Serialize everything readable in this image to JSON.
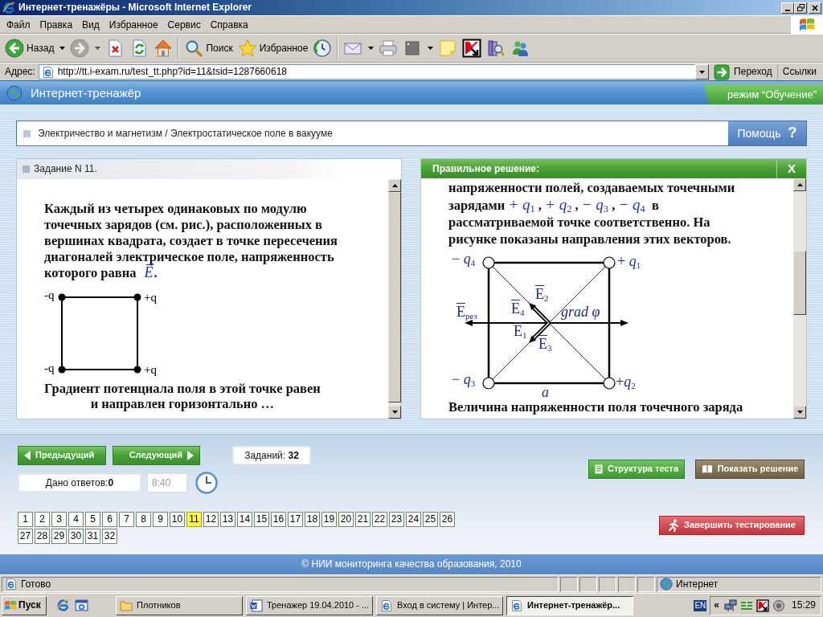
{
  "window": {
    "title": "Интернет-тренажёры - Microsoft Internet Explorer"
  },
  "menu": [
    "Файл",
    "Правка",
    "Вид",
    "Избранное",
    "Сервис",
    "Справка"
  ],
  "toolbar": [
    {
      "buttons": [
        {
          "kind": "back",
          "label": "Назад",
          "dropdown": true,
          "disabled": false
        },
        {
          "kind": "forward",
          "dropdown": true,
          "disabled": true
        },
        {
          "kind": "stop",
          "dropdown": false,
          "disabled": false
        },
        {
          "kind": "refresh",
          "dropdown": false,
          "disabled": false
        },
        {
          "kind": "home",
          "dropdown": false,
          "disabled": false
        }
      ]
    },
    {
      "buttons": [
        {
          "kind": "search",
          "label": "Поиск",
          "dropdown": false,
          "disabled": false
        },
        {
          "kind": "favorites",
          "label": "Избранное",
          "dropdown": false,
          "disabled": false
        },
        {
          "kind": "history",
          "dropdown": false,
          "disabled": false
        }
      ]
    },
    {
      "buttons": [
        {
          "kind": "mail",
          "dropdown": true,
          "disabled": false
        },
        {
          "kind": "print",
          "dropdown": false,
          "disabled": false
        },
        {
          "kind": "edit",
          "dropdown": true,
          "disabled": false
        },
        {
          "kind": "note",
          "dropdown": false,
          "disabled": false
        },
        {
          "kind": "antivirus",
          "dropdown": false,
          "disabled": false
        },
        {
          "kind": "research",
          "dropdown": false,
          "disabled": false
        },
        {
          "kind": "messenger",
          "dropdown": false,
          "disabled": false
        }
      ]
    }
  ],
  "address": {
    "label": "Адрес:",
    "url": "http://tt.i-exam.ru/test_tt.php?id=11&tsid=1287660618",
    "go": "Переход",
    "links": "Ссылки"
  },
  "page_header": {
    "title": "Интернет-тренажёр",
    "mode": "режим “Обучение”"
  },
  "breadcrumb": {
    "path": "Электричество и магнетизм / Электростатическое поле в вакууме",
    "help": "Помощь",
    "help_glyph": "?"
  },
  "task": {
    "title": "Задание N 11.",
    "text": "Каждый из четырех одинаковых по модулю точечных зарядов (см. рис.), расположенных в вершинах квадрата, создает в точке пересечения диагоналей электрическое поле, напряженность которого равна *E*.",
    "figure_labels": [
      "-q",
      "+q",
      "-q",
      "+q"
    ],
    "text_after": "Градиент потенциала поля в этой точке равен\nи направлен горизонтально …"
  },
  "solution": {
    "title": "Правильное решение:",
    "close": "X",
    "text": "напряженности полей, создаваемых точечными зарядами *+ q*$_{1}$ , *+ q*$_{2}$ , *− q*$_{3}$ , *− q*$_{4}$  в рассматриваемой точке соответственно. На рисунке показаны направления этих векторов.",
    "figure_labels": [
      {
        "kind": "charge",
        "text": "− *q*$_{4}$"
      },
      {
        "kind": "charge",
        "text": "+ *q*$_{1}$"
      },
      {
        "kind": "charge",
        "text": "− *q*$_{3}$"
      },
      {
        "kind": "charge",
        "text": "+*q*$_{2}$"
      },
      {
        "kind": "vector",
        "text": "E$_{2}$"
      },
      {
        "kind": "vector",
        "text": "E$_{4}$"
      },
      {
        "kind": "vector",
        "text": "E$_{1}$"
      },
      {
        "kind": "vector",
        "text": "E$_{3}$"
      },
      {
        "kind": "vector",
        "text": "E$_{рез}$"
      },
      {
        "kind": "quantity",
        "text": "grad φ"
      },
      {
        "kind": "quantity",
        "text": "a"
      }
    ],
    "text_after": "Величина напряженности поля точечного заряда"
  },
  "navigation": {
    "previous": "Предыдущий",
    "next": "Следующий",
    "total": "Заданий: **32**",
    "answered": "Дано ответов:**0**",
    "timer": "8:40"
  },
  "actions": [
    {
      "kind": "structure",
      "label": "Структура теста"
    },
    {
      "kind": "solution",
      "label": "Показать решение"
    }
  ],
  "finish": {
    "label": "Завершить тестирование"
  },
  "questions": [
    {
      "label": "1",
      "selected": false
    },
    {
      "label": "2",
      "selected": false
    },
    {
      "label": "3",
      "selected": false
    },
    {
      "label": "4",
      "selected": false
    },
    {
      "label": "5",
      "selected": false
    },
    {
      "label": "6",
      "selected": false
    },
    {
      "label": "7",
      "selected": false
    },
    {
      "label": "8",
      "selected": false
    },
    {
      "label": "9",
      "selected": false
    },
    {
      "label": "10",
      "selected": false
    },
    {
      "label": "11",
      "selected": true
    },
    {
      "label": "12",
      "selected": false
    },
    {
      "label": "13",
      "selected": false
    },
    {
      "label": "14",
      "selected": false
    },
    {
      "label": "15",
      "selected": false
    },
    {
      "label": "16",
      "selected": false
    },
    {
      "label": "17",
      "selected": false
    },
    {
      "label": "18",
      "selected": false
    },
    {
      "label": "19",
      "selected": false
    },
    {
      "label": "20",
      "selected": false
    },
    {
      "label": "21",
      "selected": false
    },
    {
      "label": "22",
      "selected": false
    },
    {
      "label": "23",
      "selected": false
    },
    {
      "label": "24",
      "selected": false
    },
    {
      "label": "25",
      "selected": false
    },
    {
      "label": "26",
      "selected": false
    },
    {
      "label": "27",
      "selected": false
    },
    {
      "label": "28",
      "selected": false
    },
    {
      "label": "29",
      "selected": false
    },
    {
      "label": "30",
      "selected": false
    },
    {
      "label": "31",
      "selected": false
    },
    {
      "label": "32",
      "selected": false
    }
  ],
  "footer": "© НИИ мониторинга качества образования, 2010",
  "status_bar": {
    "text": "Готово",
    "zone": "Интернет"
  },
  "taskbar": {
    "start": "Пуск",
    "tasks": [
      {
        "kind": "folder",
        "label": "Плотников",
        "selected": false
      },
      {
        "kind": "document",
        "label": "Тренажер 19.04.2010 - ...",
        "selected": false
      },
      {
        "kind": "browser",
        "label": "Вход в систему | Интер...",
        "selected": false
      },
      {
        "kind": "browser",
        "label": "Интернет-тренажёр...",
        "selected": true
      }
    ],
    "language": "EN",
    "expand": "«",
    "clock": "15:29"
  }
}
